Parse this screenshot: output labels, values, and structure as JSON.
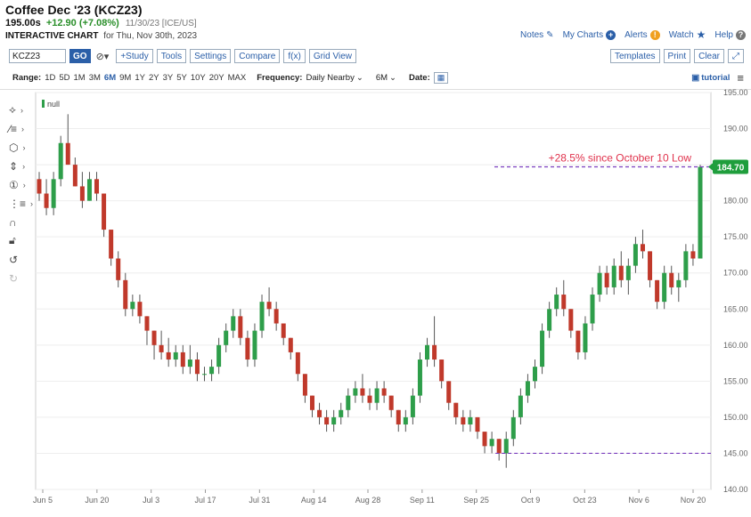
{
  "header": {
    "title": "Coffee Dec '23 (KCZ23)",
    "price": "195.00s",
    "change": "+12.90 (+7.08%)",
    "meta": "11/30/23 [ICE/US]",
    "sub_bold": "INTERACTIVE CHART",
    "sub_rest": "for Thu, Nov 30th, 2023"
  },
  "toplinks": {
    "notes": "Notes",
    "mycharts": "My Charts",
    "alerts": "Alerts",
    "watch": "Watch",
    "help": "Help"
  },
  "toolbar": {
    "symbol": "KCZ23",
    "go": "GO",
    "study": "+Study",
    "tools": "Tools",
    "settings": "Settings",
    "compare": "Compare",
    "fx": "f(x)",
    "gridview": "Grid View",
    "templates": "Templates",
    "print": "Print",
    "clear": "Clear"
  },
  "rangebar": {
    "range_label": "Range:",
    "ranges": [
      "1D",
      "5D",
      "1M",
      "3M",
      "6M",
      "9M",
      "1Y",
      "2Y",
      "3Y",
      "5Y",
      "10Y",
      "20Y",
      "MAX"
    ],
    "selected_range": "6M",
    "frequency_label": "Frequency:",
    "frequency_value": "Daily Nearby",
    "period_value": "6M",
    "date_label": "Date:",
    "tutorial": "tutorial"
  },
  "colors": {
    "up": "#2e9e4a",
    "down": "#c0392b",
    "accent": "#2b5fa8",
    "annotation": "#e0334d",
    "reference": "#7b3fbf",
    "last_price": "#1f9e3c"
  },
  "chart_data": {
    "type": "candlestick",
    "legend": "null",
    "ylim": [
      140,
      195
    ],
    "yticks": [
      140.0,
      145.0,
      150.0,
      155.0,
      160.0,
      165.0,
      170.0,
      175.0,
      180.0,
      185.0,
      190.0,
      195.0
    ],
    "xtick_labels": [
      "Jun 5",
      "Jun 20",
      "Jul 3",
      "Jul 17",
      "Jul 31",
      "Aug 14",
      "Aug 28",
      "Sep 11",
      "Sep 25",
      "Oct 9",
      "Oct 23",
      "Nov 6",
      "Nov 20"
    ],
    "last_price_label": "184.70",
    "annotation": "+28.5% since October 10 Low",
    "reference_levels": [
      184.7,
      145.0
    ],
    "candles": [
      [
        183,
        184,
        180,
        181
      ],
      [
        181,
        183,
        178,
        179
      ],
      [
        179,
        184,
        178,
        183
      ],
      [
        183,
        189,
        182,
        188
      ],
      [
        188,
        192,
        185,
        185
      ],
      [
        185,
        186,
        182,
        182
      ],
      [
        182,
        184,
        179,
        180
      ],
      [
        180,
        184,
        180,
        183
      ],
      [
        183,
        184,
        180,
        181
      ],
      [
        181,
        181,
        175,
        176
      ],
      [
        176,
        176,
        171,
        172
      ],
      [
        172,
        173,
        168,
        169
      ],
      [
        169,
        170,
        164,
        165
      ],
      [
        165,
        167,
        164,
        166
      ],
      [
        166,
        167,
        163,
        164
      ],
      [
        164,
        164,
        160,
        162
      ],
      [
        162,
        162,
        158,
        160
      ],
      [
        160,
        162,
        158,
        159
      ],
      [
        159,
        161,
        157,
        158
      ],
      [
        158,
        160,
        157,
        159
      ],
      [
        159,
        160,
        156,
        157
      ],
      [
        157,
        160,
        156,
        158
      ],
      [
        158,
        159,
        155,
        156
      ],
      [
        156,
        157,
        155,
        156
      ],
      [
        156,
        158,
        155,
        157
      ],
      [
        157,
        161,
        156,
        160
      ],
      [
        160,
        163,
        159,
        162
      ],
      [
        162,
        165,
        161,
        164
      ],
      [
        164,
        165,
        160,
        161
      ],
      [
        161,
        162,
        157,
        158
      ],
      [
        158,
        163,
        157,
        162
      ],
      [
        162,
        167,
        161,
        166
      ],
      [
        166,
        168,
        164,
        165
      ],
      [
        165,
        166,
        162,
        163
      ],
      [
        163,
        163,
        160,
        161
      ],
      [
        161,
        161,
        158,
        159
      ],
      [
        159,
        159,
        155,
        156
      ],
      [
        156,
        156,
        152,
        153
      ],
      [
        153,
        153,
        150,
        151
      ],
      [
        151,
        152,
        149,
        150
      ],
      [
        150,
        151,
        148,
        149
      ],
      [
        149,
        151,
        148,
        150
      ],
      [
        150,
        152,
        149,
        151
      ],
      [
        151,
        154,
        150,
        153
      ],
      [
        153,
        155,
        152,
        154
      ],
      [
        154,
        156,
        152,
        153
      ],
      [
        153,
        154,
        151,
        152
      ],
      [
        152,
        155,
        151,
        154
      ],
      [
        154,
        155,
        152,
        153
      ],
      [
        153,
        153,
        150,
        151
      ],
      [
        151,
        151,
        148,
        149
      ],
      [
        149,
        151,
        148,
        150
      ],
      [
        150,
        154,
        149,
        153
      ],
      [
        153,
        159,
        152,
        158
      ],
      [
        158,
        161,
        157,
        160
      ],
      [
        160,
        164,
        157,
        158
      ],
      [
        158,
        158,
        154,
        155
      ],
      [
        155,
        155,
        151,
        152
      ],
      [
        152,
        152,
        149,
        150
      ],
      [
        150,
        151,
        148,
        149
      ],
      [
        149,
        151,
        148,
        150
      ],
      [
        150,
        150,
        147,
        148
      ],
      [
        148,
        148,
        145,
        146
      ],
      [
        146,
        148,
        145,
        147
      ],
      [
        147,
        147,
        144,
        145
      ],
      [
        145,
        148,
        143,
        147
      ],
      [
        147,
        151,
        146,
        150
      ],
      [
        150,
        154,
        149,
        153
      ],
      [
        153,
        156,
        152,
        155
      ],
      [
        155,
        158,
        154,
        157
      ],
      [
        157,
        163,
        156,
        162
      ],
      [
        162,
        166,
        161,
        165
      ],
      [
        165,
        168,
        164,
        167
      ],
      [
        167,
        169,
        164,
        165
      ],
      [
        165,
        165,
        161,
        162
      ],
      [
        162,
        162,
        158,
        159
      ],
      [
        159,
        164,
        158,
        163
      ],
      [
        163,
        168,
        162,
        167
      ],
      [
        167,
        171,
        166,
        170
      ],
      [
        170,
        171,
        167,
        168
      ],
      [
        168,
        172,
        167,
        171
      ],
      [
        171,
        173,
        168,
        169
      ],
      [
        169,
        172,
        167,
        171
      ],
      [
        171,
        175,
        170,
        174
      ],
      [
        174,
        176,
        172,
        173
      ],
      [
        173,
        173,
        168,
        169
      ],
      [
        169,
        169,
        165,
        166
      ],
      [
        166,
        171,
        165,
        170
      ],
      [
        170,
        171,
        167,
        168
      ],
      [
        168,
        170,
        166,
        169
      ],
      [
        169,
        174,
        168,
        173
      ],
      [
        173,
        174,
        171,
        172
      ],
      [
        172,
        185,
        172,
        184.7
      ]
    ]
  }
}
